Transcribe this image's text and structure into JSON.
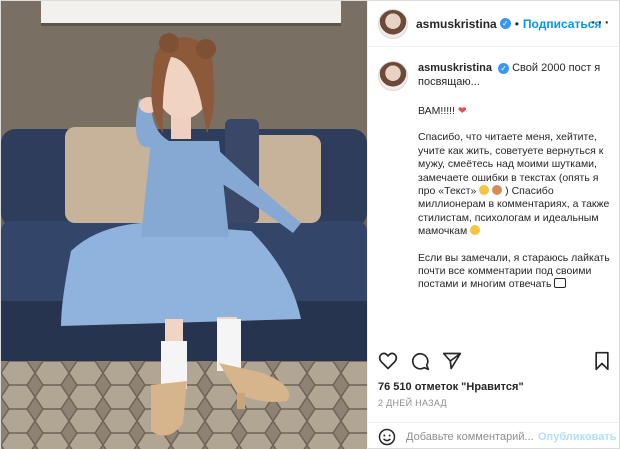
{
  "post": {
    "username": "asmuskristina",
    "verified_icon": "verified-badge-icon",
    "dot": "•",
    "follow_label": "Подписаться",
    "more_icon": "more-options-icon",
    "more_glyph": "···"
  },
  "caption": {
    "username": "asmuskristina",
    "first_line": "Свой 2000 пост я посвящаю...",
    "line_vam": "ВАМ!!!!!",
    "heart": "❤",
    "paragraph_1": "Спасибо, что читаете меня, хейтите, учите как жить, советуете вернуться к мужу, смеётесь над моими шутками, замечаете ошибки в текстах (опять я про «Текст»",
    "paragraph_1_end": ") Спасибо миллионерам в комментариях, а также стилистам, психологам и идеальным мамочкам",
    "paragraph_2": "Если вы замечали, я стараюсь лайкать почти все комментарии под своими постами и многим отвечать"
  },
  "actions": {
    "like_icon": "heart-icon",
    "comment_icon": "comment-icon",
    "share_icon": "share-icon",
    "save_icon": "bookmark-icon"
  },
  "stats": {
    "likes": "76 510 отметок \"Нравится\"",
    "time": "2 ДНЕЙ НАЗАД"
  },
  "comment": {
    "emoji_icon": "emoji-icon",
    "placeholder": "Добавьте комментарий...",
    "publish_label": "Опубликовать"
  },
  "colors": {
    "accent": "#0095f6",
    "publish_disabled": "#b2dffc",
    "heart": "#ed4956",
    "dress": "#8fb3dc",
    "sofa": "#2f3d5c"
  }
}
